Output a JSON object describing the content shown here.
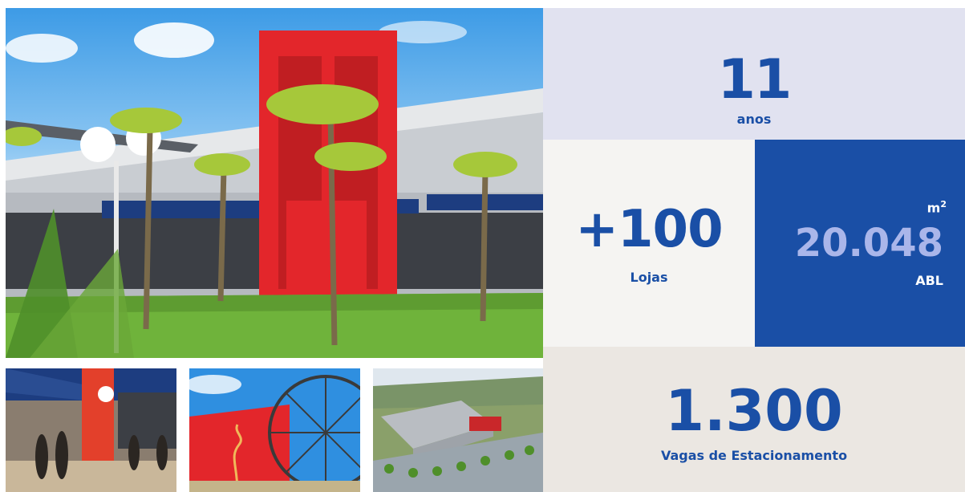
{
  "gallery": {
    "main_image": "shopping-center-photo",
    "thumbnails": [
      "storefront-photo",
      "ferris-wheel-photo",
      "aerial-render-photo"
    ]
  },
  "stats": {
    "years": {
      "value": "11",
      "label": "anos"
    },
    "stores": {
      "value": "+100",
      "label": "Lojas"
    },
    "area": {
      "unit": "m",
      "unit_sup": "2",
      "value": "20.048",
      "label": "ABL"
    },
    "parking": {
      "value": "1.300",
      "label": "Vagas de Estacionamento"
    }
  },
  "colors": {
    "brand_blue": "#1a4fa6",
    "light_blue_number": "#aab6ea",
    "panel_lavender": "#e1e2f0",
    "panel_offwhite": "#f5f4f2",
    "panel_beige": "#ebe7e2",
    "tower_red": "#e3262b"
  }
}
